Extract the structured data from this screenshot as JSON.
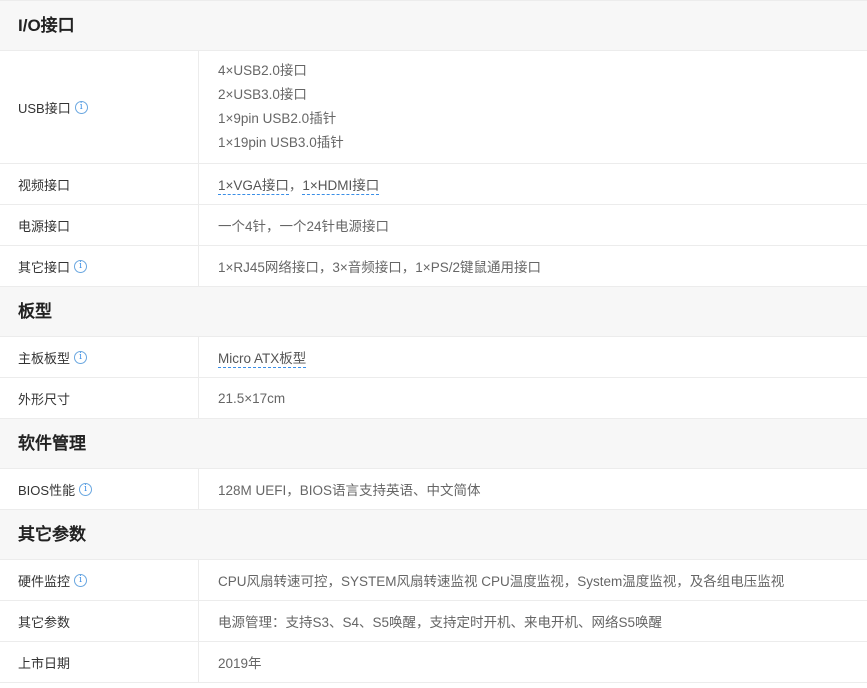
{
  "sections": {
    "io": {
      "title": "I/O接口",
      "usb": {
        "label": "USB接口",
        "lines": [
          "4×USB2.0接口",
          "2×USB3.0接口",
          "1×9pin USB2.0插针",
          "1×19pin USB3.0插针"
        ]
      },
      "video": {
        "label": "视频接口",
        "items": [
          "1×VGA接口",
          "1×HDMI接口"
        ],
        "separator": "，"
      },
      "power": {
        "label": "电源接口",
        "value": "一个4针，一个24针电源接口"
      },
      "other": {
        "label": "其它接口",
        "value": "1×RJ45网络接口，3×音频接口，1×PS/2键鼠通用接口"
      }
    },
    "board": {
      "title": "板型",
      "form": {
        "label": "主板板型",
        "value": "Micro ATX板型"
      },
      "size": {
        "label": "外形尺寸",
        "value": "21.5×17cm"
      }
    },
    "software": {
      "title": "软件管理",
      "bios": {
        "label": "BIOS性能",
        "value": "128M UEFI，BIOS语言支持英语、中文简体"
      }
    },
    "misc": {
      "title": "其它参数",
      "monitor": {
        "label": "硬件监控",
        "value": "CPU风扇转速可控，SYSTEM风扇转速监视 CPU温度监视，System温度监视，及各组电压监视"
      },
      "params": {
        "label": "其它参数",
        "value": "电源管理：支持S3、S4、S5唤醒，支持定时开机、来电开机、网络S5唤醒"
      },
      "date": {
        "label": "上市日期",
        "value": "2019年"
      }
    }
  },
  "icons": {
    "info": "i"
  },
  "colors": {
    "link_underline": "#3a8ee6",
    "section_bg": "#f7f7f7",
    "border": "#ececec"
  }
}
